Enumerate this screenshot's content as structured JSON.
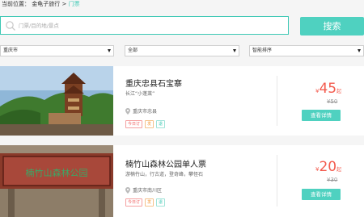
{
  "breadcrumb": {
    "prefix": "当前位置：",
    "site": "金龟子旅行",
    "separator": ">",
    "current": "门票"
  },
  "search": {
    "placeholder": "门票/目的地/景点",
    "button_label": "搜索"
  },
  "filters": [
    {
      "label": "重庆市"
    },
    {
      "label": "全部"
    },
    {
      "label": "智能排序"
    }
  ],
  "listings": [
    {
      "title": "重庆忠县石宝寨",
      "subtitle": "长江“小蓬莱”",
      "location": "重庆市忠县",
      "tags": [
        "今日订",
        "发",
        "退"
      ],
      "price_symbol": "¥",
      "price": "45",
      "price_suffix": "起",
      "original_price": "¥50",
      "detail_label": "查看详情",
      "image_sign": "石宝寨"
    },
    {
      "title": "楠竹山森林公园单人票",
      "subtitle": "游楠竹山，行古道，登奇峰，攀怪石",
      "location": "重庆市南川区",
      "tags": [
        "今日订",
        "发",
        "退"
      ],
      "price_symbol": "¥",
      "price": "20",
      "price_suffix": "起",
      "original_price": "¥30",
      "detail_label": "查看详情",
      "image_sign": "楠竹山森林公园"
    }
  ],
  "colors": {
    "accent": "#4fd1c0",
    "price": "#f35b4e"
  }
}
